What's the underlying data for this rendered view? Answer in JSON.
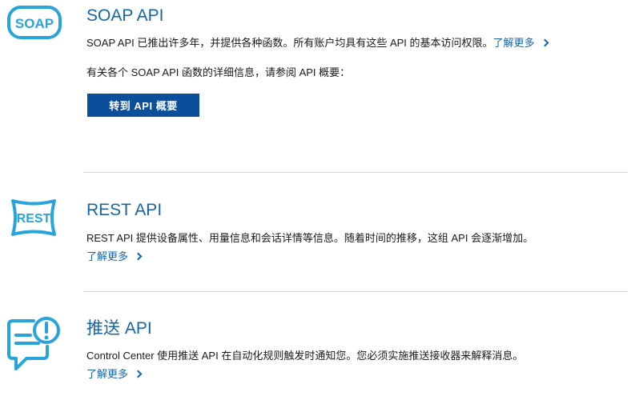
{
  "soap": {
    "icon": "soap-icon",
    "icon_text": "SOAP",
    "title": "SOAP API",
    "desc": "SOAP API 已推出许多年，并提供各种函数。所有账户均具有这些 API 的基本访问权限。",
    "learn_more": "了解更多",
    "detail": "有关各个 SOAP API 函数的详细信息，请参阅 API 概要：",
    "button": "转到 API 概要"
  },
  "rest": {
    "icon": "rest-icon",
    "icon_text": "REST",
    "title": "REST API",
    "desc": "REST API 提供设备属性、用量信息和会话详情等信息。随着时间的推移，这组 API 会逐渐增加。",
    "learn_more": "了解更多"
  },
  "push": {
    "icon": "push-notification-icon",
    "title": "推送 API",
    "desc": "Control Center 使用推送 API 在自动化规则触发时通知您。您必须实施推送接收器来解释消息。",
    "learn_more": "了解更多"
  },
  "colors": {
    "accent": "#1565a7",
    "icon": "#29a3dc",
    "button_bg": "#0b4f9a",
    "divider": "#d6d6d6"
  }
}
